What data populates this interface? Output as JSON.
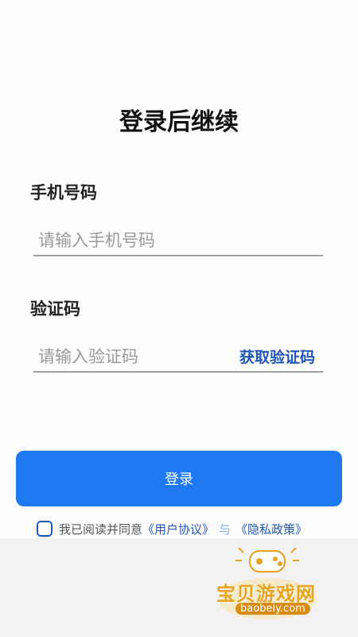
{
  "header": {
    "title": "登录后继续"
  },
  "phone": {
    "label": "手机号码",
    "placeholder": "请输入手机号码"
  },
  "code": {
    "label": "验证码",
    "placeholder": "请输入验证码",
    "get_code_label": "获取验证码"
  },
  "login": {
    "button_label": "登录"
  },
  "agreement": {
    "prefix": "我已阅读并同意",
    "user_agreement": "《用户协议》",
    "connector": "与",
    "privacy_policy": "《隐私政策》",
    "checked": false
  },
  "watermark": {
    "text": "宝贝游戏网",
    "url": "baobeiy.com"
  },
  "colors": {
    "primary": "#1f79f2",
    "link": "#1f57b8",
    "watermark": "#e8a21e"
  }
}
